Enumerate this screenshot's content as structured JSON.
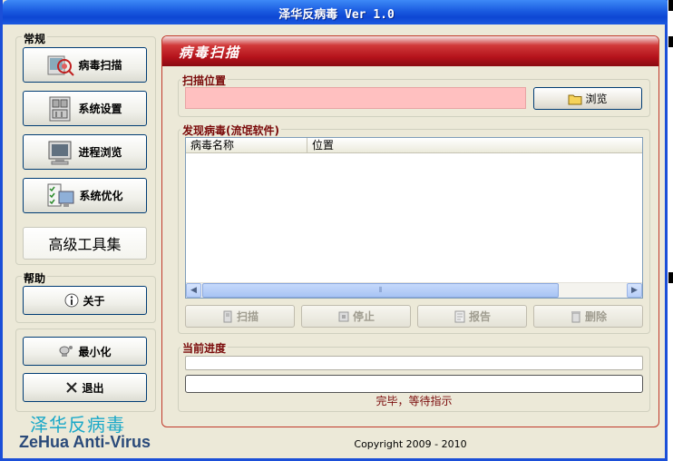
{
  "window": {
    "title": "泽华反病毒 Ver 1.0"
  },
  "sidebar": {
    "group_general": "常规",
    "buttons": [
      {
        "label": "病毒扫描",
        "icon": "virus-scan-icon"
      },
      {
        "label": "系统设置",
        "icon": "system-settings-icon"
      },
      {
        "label": "进程浏览",
        "icon": "process-monitor-icon"
      },
      {
        "label": "系统优化",
        "icon": "system-optimize-icon"
      }
    ],
    "tools_label": "高级工具集",
    "group_help": "帮助",
    "about_label": "关于",
    "minimize_label": "最小化",
    "exit_label": "退出"
  },
  "brand": {
    "chinese": "泽华反病毒",
    "english": "ZeHua Anti-Virus"
  },
  "panel": {
    "title": "病毒扫描",
    "scan_location_label": "扫描位置",
    "scan_path_value": "",
    "browse_label": "浏览",
    "found_label": "发现病毒(流氓软件)",
    "columns": [
      "病毒名称",
      "位置"
    ],
    "rows": [],
    "actions": [
      {
        "label": "扫描",
        "icon": "scan-icon"
      },
      {
        "label": "停止",
        "icon": "stop-icon"
      },
      {
        "label": "报告",
        "icon": "report-icon"
      },
      {
        "label": "删除",
        "icon": "trash-icon"
      }
    ],
    "progress_label": "当前进度",
    "file_progress": 0,
    "total_progress": 0,
    "status_text": "完毕，等待指示"
  },
  "footer": {
    "copyright": "Copyright  2009 - 2010"
  },
  "colors": {
    "accent_red": "#b4121b",
    "title_blue": "#1a5be0",
    "path_bg": "#ffc0c0"
  }
}
